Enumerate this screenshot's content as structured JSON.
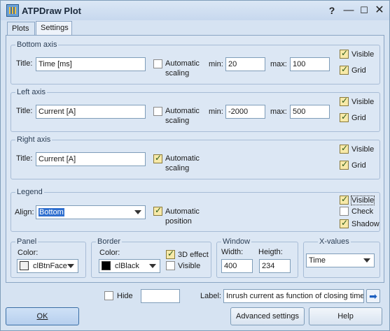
{
  "window": {
    "title": "ATPDraw Plot"
  },
  "tabs": {
    "plots": "Plots",
    "settings": "Settings"
  },
  "bottom_axis": {
    "group_title": "Bottom axis",
    "title_label": "Title:",
    "title_value": "Time [ms]",
    "auto_label_1": "Automatic",
    "auto_label_2": "scaling",
    "auto_checked": false,
    "min_label": "min:",
    "min_value": "20",
    "max_label": "max:",
    "max_value": "100",
    "visible_label": "Visible",
    "grid_label": "Grid"
  },
  "left_axis": {
    "group_title": "Left axis",
    "title_label": "Title:",
    "title_value": "Current [A]",
    "auto_label_1": "Automatic",
    "auto_label_2": "scaling",
    "min_label": "min:",
    "min_value": "-2000",
    "max_label": "max:",
    "max_value": "500",
    "visible_label": "Visible",
    "grid_label": "Grid"
  },
  "right_axis": {
    "group_title": "Right axis",
    "title_label": "Title:",
    "title_value": "Current [A]",
    "auto_label_1": "Automatic",
    "auto_label_2": "scaling",
    "visible_label": "Visible",
    "grid_label": "Grid"
  },
  "legend": {
    "group_title": "Legend",
    "align_label": "Align:",
    "align_value": "Bottom",
    "auto_label_1": "Automatic",
    "auto_label_2": "position",
    "visible_label": "Visible",
    "check_label": "Check",
    "shadow_label": "Shadow"
  },
  "panel": {
    "group_title": "Panel",
    "color_label": "Color:",
    "color_value": "clBtnFace",
    "color_swatch": "#f0f0f0"
  },
  "border": {
    "group_title": "Border",
    "color_label": "Color:",
    "color_value": "clBlack",
    "color_swatch": "#000000",
    "effect_label": "3D effect",
    "visible_label": "Visible"
  },
  "window_group": {
    "group_title": "Window",
    "width_label": "Width:",
    "width_value": "400",
    "height_label": "Heigth:",
    "height_value": "234"
  },
  "xvalues": {
    "group_title": "X-values",
    "value": "Time"
  },
  "bottom_bar": {
    "hide_label": "Hide",
    "hide_value": "",
    "label_label": "Label:",
    "label_value": "Inrush current as function of closing time"
  },
  "buttons": {
    "ok": "OK",
    "advanced": "Advanced settings",
    "help": "Help"
  }
}
